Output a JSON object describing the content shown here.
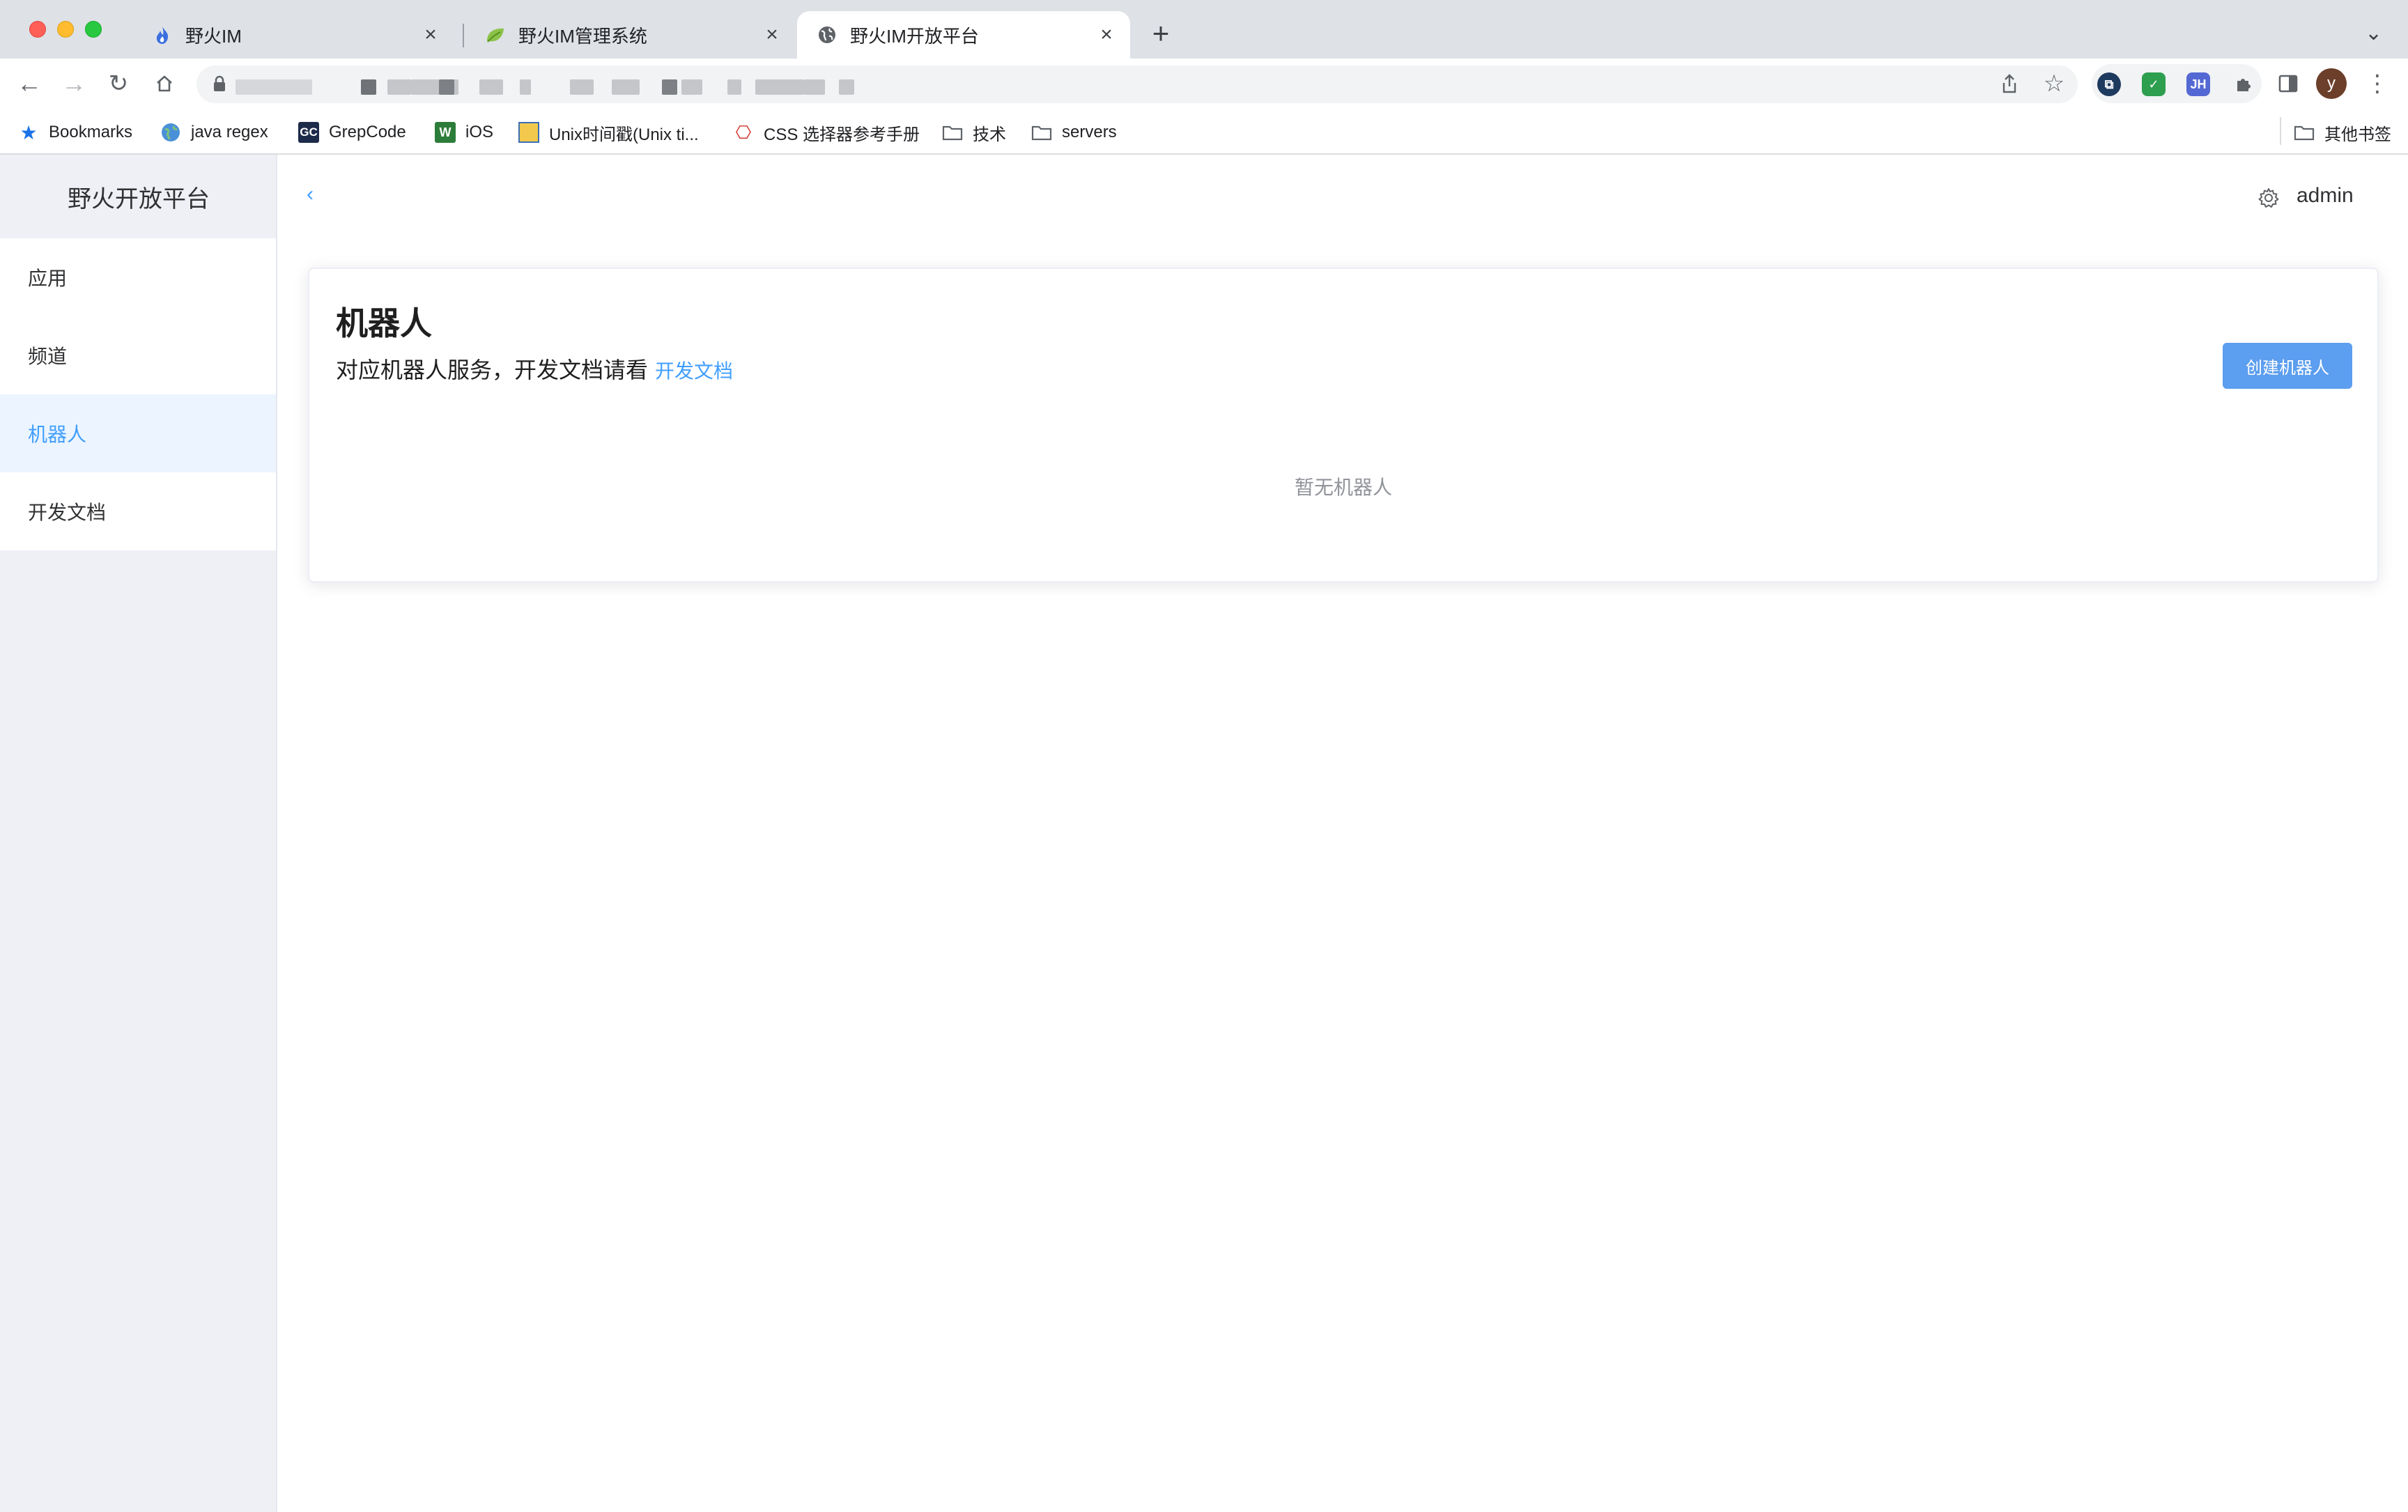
{
  "browser": {
    "tabs": [
      {
        "title": "野火IM",
        "icon": "flame-icon"
      },
      {
        "title": "野火IM管理系统",
        "icon": "leaf-icon"
      },
      {
        "title": "野火IM开放平台",
        "icon": "globe-icon"
      }
    ],
    "bookmarks": [
      {
        "label": "Bookmarks",
        "icon": "star-icon"
      },
      {
        "label": "java regex",
        "icon": "globe-icon"
      },
      {
        "label": "GrepCode",
        "icon": "grepcode-icon",
        "badge": "GC"
      },
      {
        "label": "iOS",
        "icon": "ios-icon"
      },
      {
        "label": "Unix时间戳(Unix ti...",
        "icon": "unix-icon"
      },
      {
        "label": "CSS 选择器参考手册",
        "icon": "css-icon"
      },
      {
        "label": "技术",
        "icon": "folder-icon"
      },
      {
        "label": "servers",
        "icon": "folder-icon"
      }
    ],
    "other_bookmarks": "其他书签",
    "extensions": {
      "jh_label": "JH"
    },
    "profile_initial": "y"
  },
  "sidebar": {
    "brand": "野火开放平台",
    "items": [
      {
        "label": "应用",
        "active": false
      },
      {
        "label": "频道",
        "active": false
      },
      {
        "label": "机器人",
        "active": true
      },
      {
        "label": "开发文档",
        "active": false
      }
    ]
  },
  "header": {
    "user": "admin"
  },
  "card": {
    "title": "机器人",
    "description": "对应机器人服务，开发文档请看",
    "doc_link": "开发文档",
    "create_button": "创建机器人",
    "empty_text": "暂无机器人"
  },
  "colors": {
    "accent": "#409eff",
    "button": "#5c9eef",
    "sidebar_bg": "#eef0f5",
    "active_item_bg": "#ecf5ff"
  }
}
